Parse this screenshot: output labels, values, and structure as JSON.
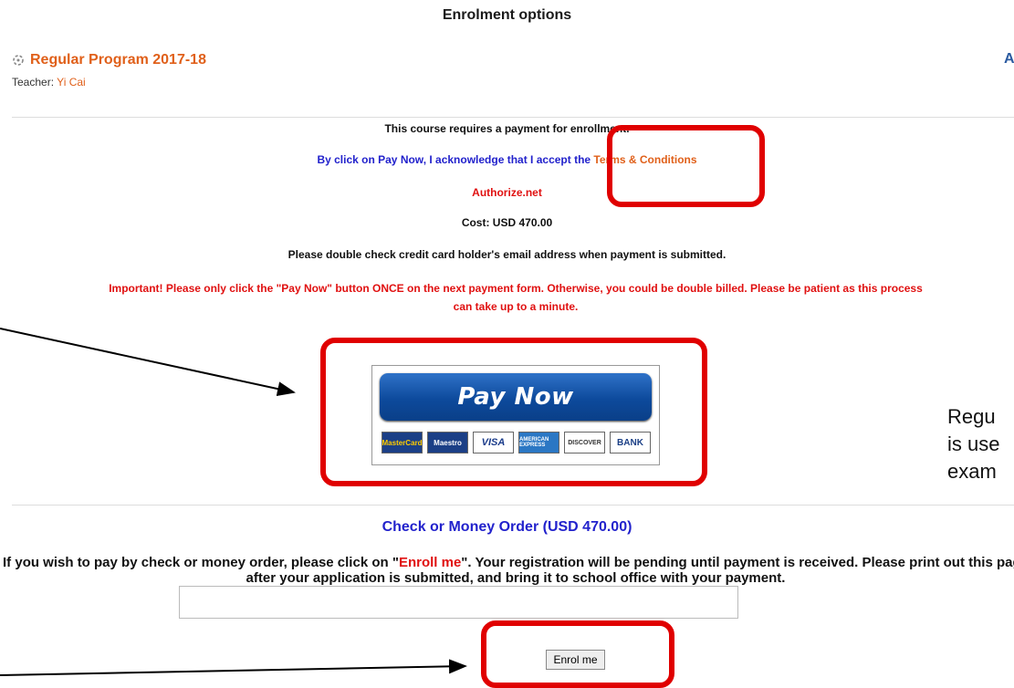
{
  "page": {
    "title": "Enrolment options"
  },
  "course": {
    "name": "Regular Program 2017-18",
    "teacher_label": "Teacher: ",
    "teacher_name": "Yi Cai",
    "corner_mark": "A"
  },
  "payment": {
    "requirement": "This course requires a payment for enrollment.",
    "terms_prefix": "By click on Pay Now, I acknowledge that I accept the ",
    "terms_link": "Terms & Conditions",
    "processor": "Authorize.net",
    "cost": "Cost: USD 470.00",
    "email_notice": "Please double check credit card holder's email address when payment is submitted.",
    "important_line1": "Important! Please only click the \"Pay Now\" button ONCE on the next payment form. Otherwise, you could be double billed. Please be patient as this process",
    "important_line2": "can take up to a minute.",
    "pay_button_label": "Pay Now",
    "cards": [
      "MasterCard",
      "Maestro",
      "VISA",
      "AMERICAN EXPRESS",
      "DISCOVER",
      "BANK"
    ]
  },
  "check": {
    "heading": "Check or Money Order (USD 470.00)",
    "text_before": "If you wish to pay by check or money order, please click on \"",
    "text_highlight": "Enroll me",
    "text_after": "\". Your registration will be pending until payment is received. Please print out this page after your application is submitted, and bring it to school office with your payment.",
    "comment_value": "",
    "enrol_button_label": "Enrol me"
  },
  "annotation": {
    "side_line1": "Regu",
    "side_line2": "is use",
    "side_line3": "exam",
    "highlight_color": "#e00000"
  }
}
